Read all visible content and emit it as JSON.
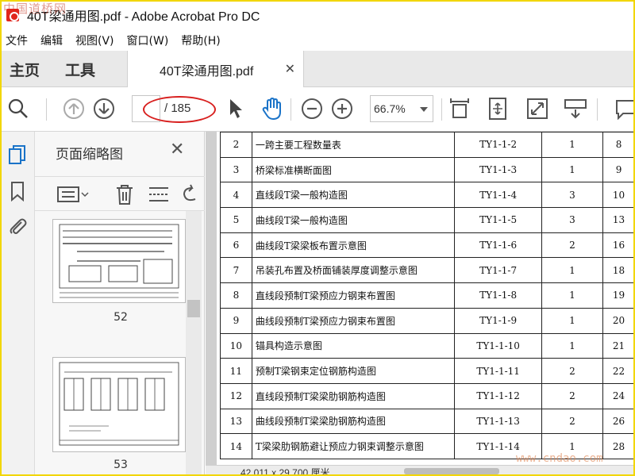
{
  "window": {
    "title": "40T梁通用图.pdf - Adobe Acrobat Pro DC",
    "watermark_top": "中国道桥网"
  },
  "menu": [
    "文件",
    "编辑",
    "视图(V)",
    "窗口(W)",
    "帮助(H)"
  ],
  "tabs": {
    "home": "主页",
    "tools": "工具",
    "document": "40T梁通用图.pdf"
  },
  "toolbar": {
    "page_current": "",
    "page_total": "/ 185",
    "zoom": "66.7%"
  },
  "thumbnails_panel": {
    "title": "页面缩略图",
    "pages": [
      "52",
      "53"
    ]
  },
  "document": {
    "rows": [
      {
        "no": "2",
        "name": "一跨主要工程数量表",
        "code": "TY1-1-2",
        "qty": "1",
        "page": "8"
      },
      {
        "no": "3",
        "name": "桥梁标准横断面图",
        "code": "TY1-1-3",
        "qty": "1",
        "page": "9"
      },
      {
        "no": "4",
        "name": "直线段T梁一般构造图",
        "code": "TY1-1-4",
        "qty": "3",
        "page": "10"
      },
      {
        "no": "5",
        "name": "曲线段T梁一般构造图",
        "code": "TY1-1-5",
        "qty": "3",
        "page": "13"
      },
      {
        "no": "6",
        "name": "曲线段T梁梁板布置示意图",
        "code": "TY1-1-6",
        "qty": "2",
        "page": "16"
      },
      {
        "no": "7",
        "name": "吊装孔布置及桥面铺装厚度调整示意图",
        "code": "TY1-1-7",
        "qty": "1",
        "page": "18"
      },
      {
        "no": "8",
        "name": "直线段预制T梁预应力钢束布置图",
        "code": "TY1-1-8",
        "qty": "1",
        "page": "19"
      },
      {
        "no": "9",
        "name": "曲线段预制T梁预应力钢束布置图",
        "code": "TY1-1-9",
        "qty": "1",
        "page": "20"
      },
      {
        "no": "10",
        "name": "锚具构造示意图",
        "code": "TY1-1-10",
        "qty": "1",
        "page": "21"
      },
      {
        "no": "11",
        "name": "预制T梁钢束定位钢筋构造图",
        "code": "TY1-1-11",
        "qty": "2",
        "page": "22"
      },
      {
        "no": "12",
        "name": "直线段预制T梁梁肋钢筋构造图",
        "code": "TY1-1-12",
        "qty": "2",
        "page": "24"
      },
      {
        "no": "13",
        "name": "曲线段预制T梁梁肋钢筋构造图",
        "code": "TY1-1-13",
        "qty": "2",
        "page": "26"
      },
      {
        "no": "14",
        "name": "T梁梁肋钢筋避让预应力钢束调整示意图",
        "code": "TY1-1-14",
        "qty": "1",
        "page": "28"
      }
    ],
    "page_size": "42.011 x 29.700 厘米"
  },
  "watermark_bottom": "www.cndao.com",
  "colors": {
    "accent_blue": "#1a73c8",
    "annotation_red": "#d8201f",
    "frame_yellow": "#f2d600"
  }
}
